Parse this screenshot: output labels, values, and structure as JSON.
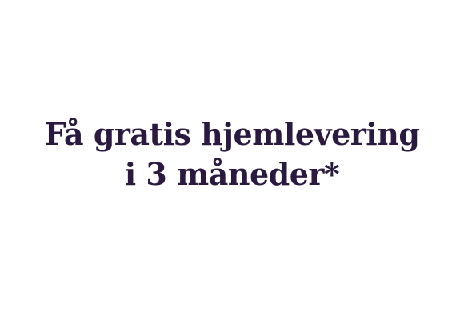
{
  "headline": {
    "line1": "Få gratis hjemlevering",
    "line2": "i 3 måneder*"
  },
  "colors": {
    "background": "#ffffff",
    "headline_text": "#2b1a3f"
  }
}
